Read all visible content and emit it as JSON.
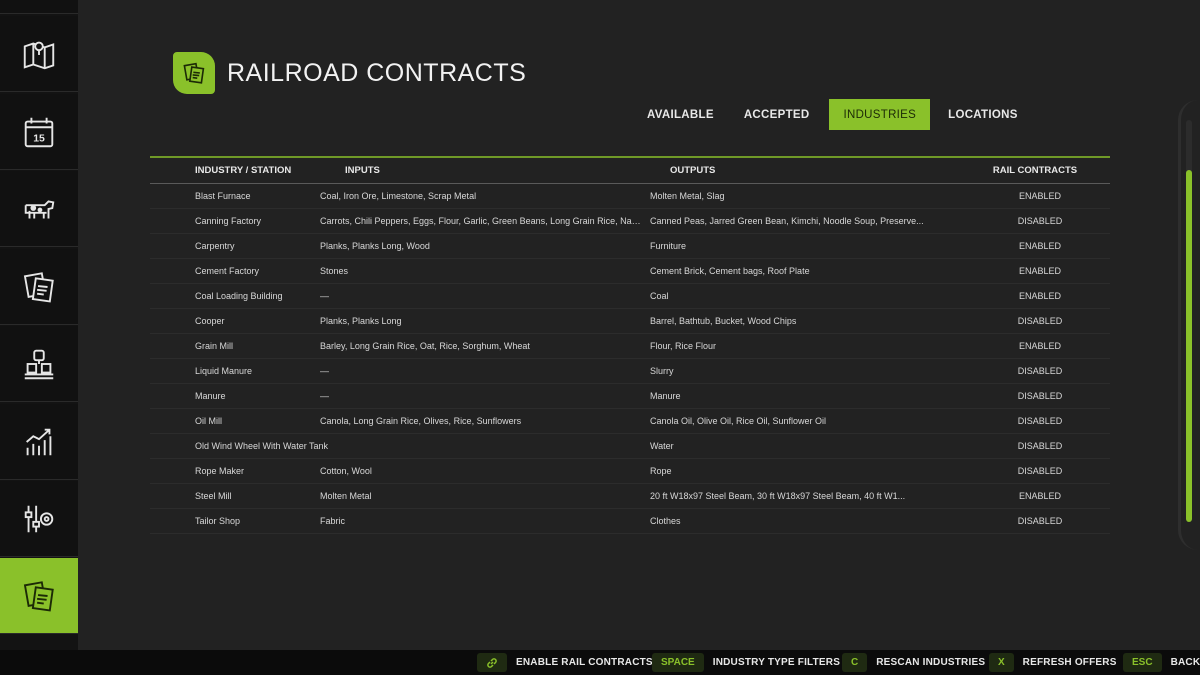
{
  "sidebar": {
    "items": [
      {
        "icon": "map-icon"
      },
      {
        "icon": "calendar-icon",
        "day": "15"
      },
      {
        "icon": "animals-icon"
      },
      {
        "icon": "contracts-icon"
      },
      {
        "icon": "production-icon"
      },
      {
        "icon": "statistics-icon"
      },
      {
        "icon": "settings-icon"
      },
      {
        "icon": "railroad-contracts-icon",
        "active": true
      }
    ]
  },
  "header": {
    "title": "RAILROAD CONTRACTS"
  },
  "tabs": [
    {
      "label": "AVAILABLE"
    },
    {
      "label": "ACCEPTED"
    },
    {
      "label": "INDUSTRIES",
      "active": true
    },
    {
      "label": "LOCATIONS"
    }
  ],
  "table": {
    "columns": [
      "INDUSTRY / STATION",
      "INPUTS",
      "OUTPUTS",
      "RAIL CONTRACTS"
    ],
    "rows": [
      {
        "name": "Blast Furnace",
        "inputs": "Coal, Iron Ore, Limestone, Scrap Metal",
        "outputs": "Molten Metal, Slag",
        "rail": "ENABLED"
      },
      {
        "name": "Canning Factory",
        "inputs": "Carrots, Chili Peppers, Eggs, Flour, Garlic, Green Beans, Long Grain Rice, Napa ...",
        "outputs": "Canned Peas, Jarred Green Bean, Kimchi, Noodle Soup, Preserve...",
        "rail": "DISABLED"
      },
      {
        "name": "Carpentry",
        "inputs": "Planks, Planks Long, Wood",
        "outputs": "Furniture",
        "rail": "ENABLED"
      },
      {
        "name": "Cement Factory",
        "inputs": "Stones",
        "outputs": "Cement Brick, Cement bags, Roof Plate",
        "rail": "ENABLED"
      },
      {
        "name": "Coal Loading Building",
        "inputs": "—",
        "outputs": "Coal",
        "rail": "ENABLED"
      },
      {
        "name": "Cooper",
        "inputs": "Planks, Planks Long",
        "outputs": "Barrel, Bathtub, Bucket, Wood Chips",
        "rail": "DISABLED"
      },
      {
        "name": "Grain Mill",
        "inputs": "Barley, Long Grain Rice, Oat, Rice, Sorghum, Wheat",
        "outputs": "Flour, Rice Flour",
        "rail": "ENABLED"
      },
      {
        "name": "Liquid Manure",
        "inputs": "—",
        "outputs": "Slurry",
        "rail": "DISABLED"
      },
      {
        "name": "Manure",
        "inputs": "—",
        "outputs": "Manure",
        "rail": "DISABLED"
      },
      {
        "name": "Oil Mill",
        "inputs": "Canola, Long Grain Rice, Olives, Rice, Sunflowers",
        "outputs": "Canola Oil, Olive Oil, Rice Oil, Sunflower Oil",
        "rail": "DISABLED"
      },
      {
        "name": "Old Wind Wheel With Water Tank",
        "inputs": "",
        "outputs": "Water",
        "rail": "DISABLED"
      },
      {
        "name": "Rope Maker",
        "inputs": "Cotton, Wool",
        "outputs": "Rope",
        "rail": "DISABLED"
      },
      {
        "name": "Steel Mill",
        "inputs": "Molten Metal",
        "outputs": "20 ft W18x97 Steel Beam, 30 ft W18x97 Steel Beam, 40 ft W1...",
        "rail": "ENABLED"
      },
      {
        "name": "Tailor Shop",
        "inputs": "Fabric",
        "outputs": "Clothes",
        "rail": "DISABLED"
      }
    ]
  },
  "footer": {
    "hints": [
      {
        "key": "",
        "key_icon": "link-icon",
        "label": "ENABLE RAIL CONTRACTS"
      },
      {
        "key": "SPACE",
        "label": "INDUSTRY TYPE FILTERS"
      },
      {
        "key": "C",
        "label": "RESCAN INDUSTRIES"
      },
      {
        "key": "X",
        "label": "REFRESH OFFERS"
      },
      {
        "key": "ESC",
        "label": "BACK"
      }
    ]
  },
  "colors": {
    "accent": "#8ac12a",
    "background": "#222222",
    "sidebar": "#111111",
    "footer": "#0b0b0b"
  }
}
